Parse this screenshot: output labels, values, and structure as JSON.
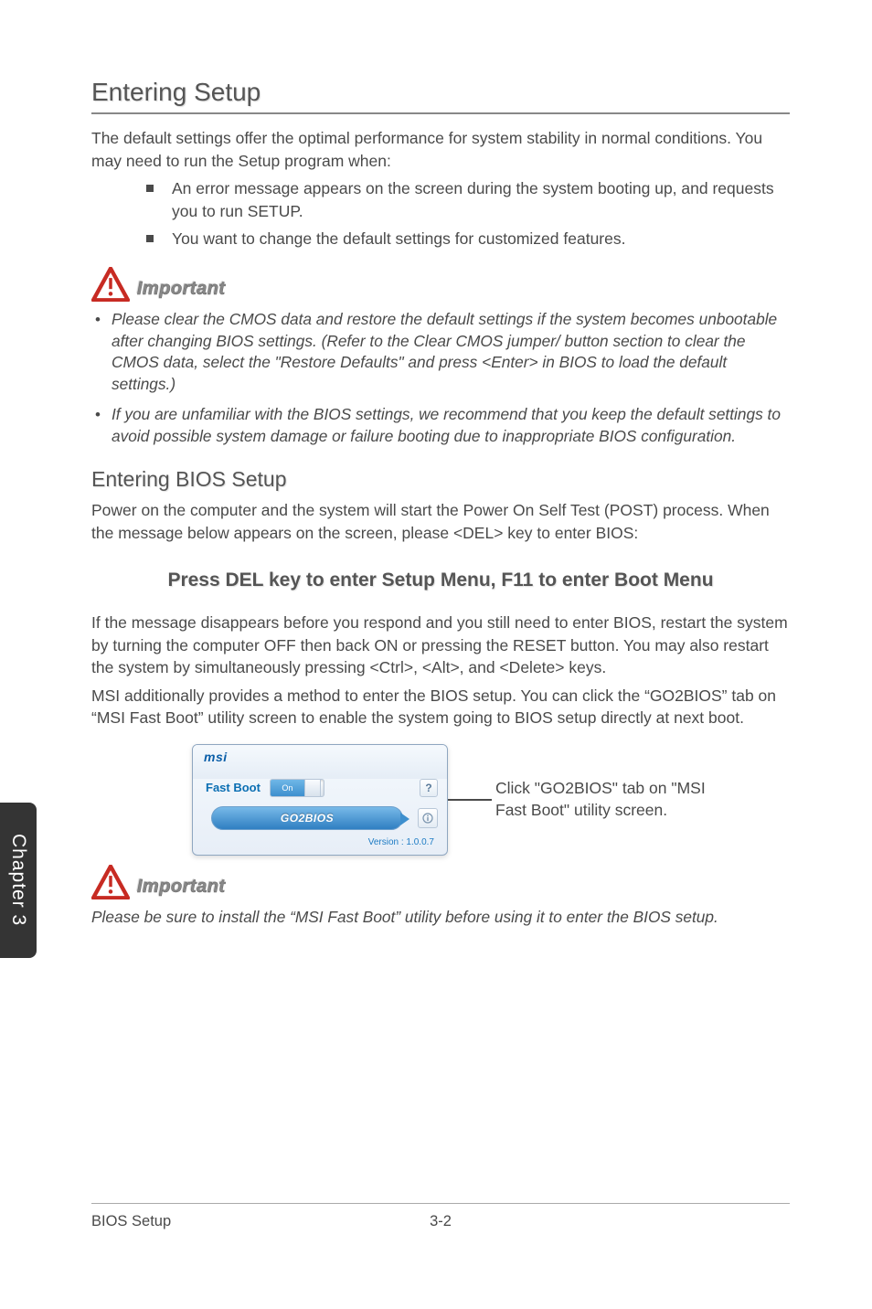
{
  "titles": {
    "section": "Entering Setup",
    "subsection": "Entering BIOS Setup",
    "important": "Important"
  },
  "intro": "The default settings offer the optimal performance for system stability in normal conditions. You may need to run the Setup program when:",
  "bullets_square": [
    "An error message appears on the screen during the system booting up, and requests you to run SETUP.",
    "You want to change the default settings for customized features."
  ],
  "important1": [
    "Please clear the CMOS data and restore the default settings if the system becomes unbootable after changing BIOS settings. (Refer to the Clear CMOS jumper/ button section to clear the CMOS data, select the \"Restore Defaults\" and press <Enter> in BIOS to load the default settings.)",
    "If you are unfamiliar with the BIOS settings, we recommend that you keep the default settings to avoid possible system damage or failure booting due to inappropriate BIOS configuration."
  ],
  "post_text": "Power on the computer and the system will start the Power On Self Test (POST) process. When the message below appears on the screen, please <DEL> key to enter BIOS:",
  "bios_prompt": "Press DEL key to enter Setup Menu, F11 to enter Boot Menu",
  "after_prompt_1": "If the message disappears before you respond and you still need to enter BIOS, restart the system by turning the computer OFF then back ON or pressing the RESET button. You may also restart the system by simultaneously pressing <Ctrl>, <Alt>, and <Delete> keys.",
  "after_prompt_2": "MSI additionally provides a method to enter the BIOS setup. You can click the “GO2BIOS” tab on “MSI Fast Boot” utility screen to enable the system going to BIOS setup directly at next boot.",
  "msi_window": {
    "logo": "msi",
    "fast_boot_label": "Fast Boot",
    "toggle_on": "On",
    "help": "?",
    "go2bios": "GO2BIOS",
    "version": "Version : 1.0.0.7"
  },
  "callout": "Click \"GO2BIOS\" tab on \"MSI Fast Boot\" utility screen.",
  "important2": "Please be sure to install the “MSI Fast Boot” utility before using it to enter the BIOS setup.",
  "side_tab": "Chapter 3",
  "footer": {
    "left": "BIOS Setup",
    "center": "3-2"
  }
}
